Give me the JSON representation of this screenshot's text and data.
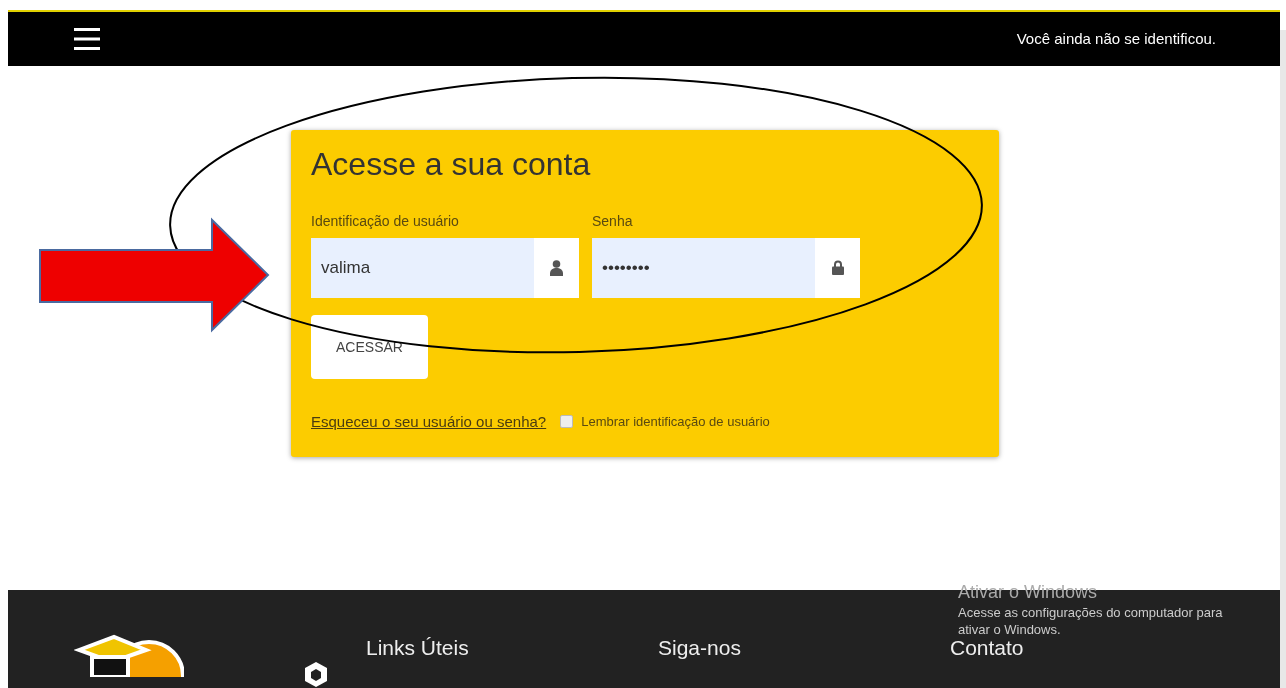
{
  "header": {
    "status": "Você ainda não se identificou."
  },
  "login": {
    "title": "Acesse a sua conta",
    "username": {
      "label": "Identificação de usuário",
      "value": "valima"
    },
    "password": {
      "label": "Senha",
      "value": "••••••••"
    },
    "submit": "ACESSAR",
    "forgot_link": "Esqueceu o seu usuário ou senha?",
    "remember": {
      "label": "Lembrar identificação de usuário",
      "checked": false
    }
  },
  "footer": {
    "columns": [
      "Links Úteis",
      "Siga-nos",
      "Contato"
    ]
  },
  "windows_activation": {
    "title": "Ativar o Windows",
    "message": "Acesse as configurações do computador para ativar o Windows."
  }
}
